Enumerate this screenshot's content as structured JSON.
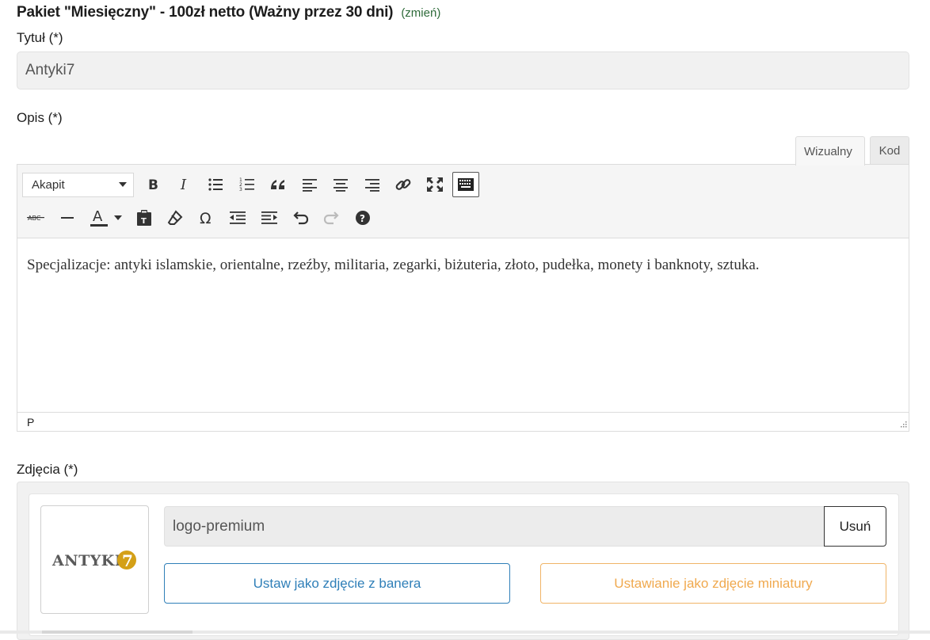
{
  "package": {
    "title": "Pakiet \"Miesięczny\" - 100zł netto (Ważny przez 30 dni)",
    "change_link": "(zmień)"
  },
  "title_field": {
    "label": "Tytuł (*)",
    "value": "Antyki7"
  },
  "description": {
    "label": "Opis (*)",
    "tabs": [
      "Wizualny",
      "Kod"
    ],
    "active_tab": "Wizualny",
    "format_select": "Akapit",
    "toolbar_row1": [
      "bold-icon",
      "italic-icon",
      "bullet-list-icon",
      "numbered-list-icon",
      "blockquote-icon",
      "align-left-icon",
      "align-center-icon",
      "align-right-icon",
      "link-icon",
      "fullscreen-icon",
      "toolbar-toggle-icon"
    ],
    "toolbar_row2": [
      "strikethrough-icon",
      "horizontal-line-icon",
      "text-color-icon",
      "paste-text-icon",
      "clear-formatting-icon",
      "special-character-icon",
      "outdent-icon",
      "indent-icon",
      "undo-icon",
      "redo-icon",
      "help-icon"
    ],
    "content": "Specjalizacje: antyki islamskie, orientalne, rzeźby, militaria, zegarki, biżuteria, złoto, pudełka, monety i banknoty, sztuka.",
    "status_path": "P"
  },
  "photos": {
    "label": "Zdjęcia (*)",
    "items": [
      {
        "name": "logo-premium",
        "logo_text": "ANTYKI",
        "logo_number": "7",
        "remove_label": "Usuń",
        "banner_label": "Ustaw jako zdjęcie z banera",
        "thumbnail_label": "Ustawianie jako zdjęcie miniatury"
      }
    ]
  },
  "colors": {
    "change_link": "#2e6b3a",
    "banner_button": "#2f7fb8",
    "thumbnail_button": "#f0a94e",
    "logo_gold": "#d4a017"
  }
}
